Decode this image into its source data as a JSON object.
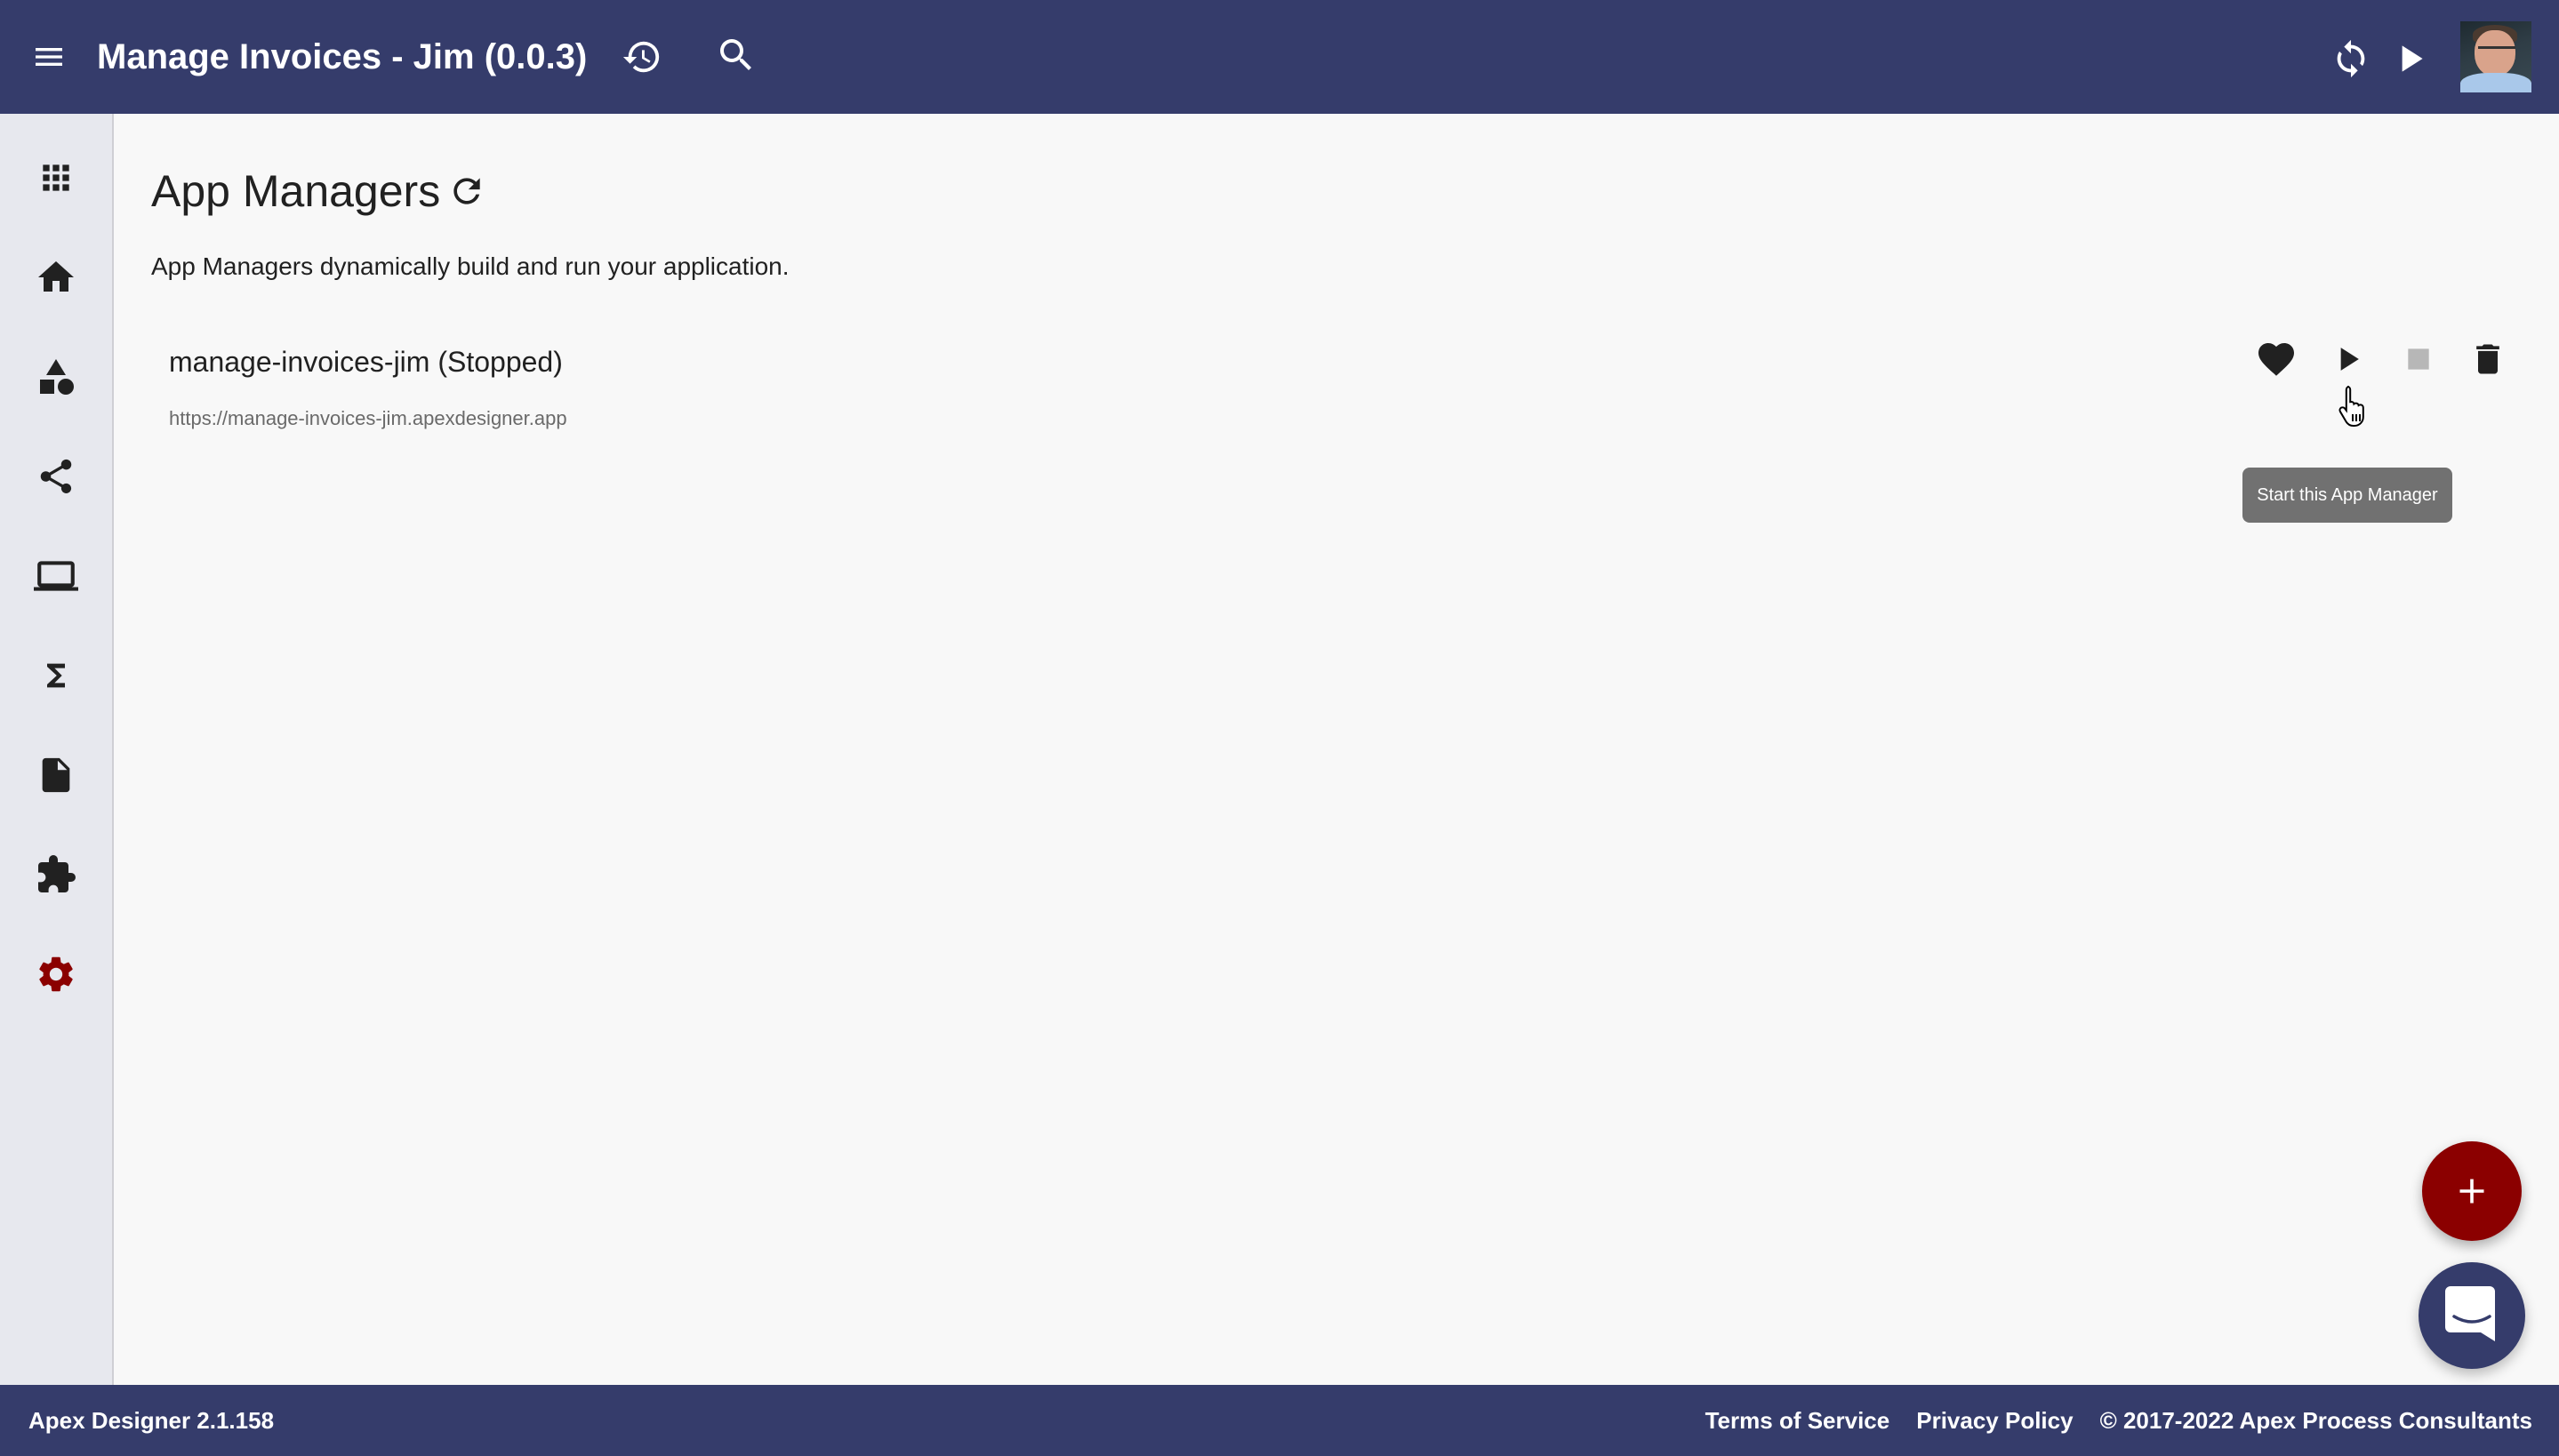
{
  "header": {
    "title": "Manage Invoices - Jim (0.0.3)",
    "icons": [
      "menu-icon",
      "history-icon",
      "search-icon",
      "sync-icon",
      "play-icon",
      "user-avatar"
    ]
  },
  "sidebar": {
    "items": [
      {
        "name": "apps",
        "icon": "apps-grid-icon"
      },
      {
        "name": "home",
        "icon": "home-icon"
      },
      {
        "name": "business-objects",
        "icon": "shapes-icon"
      },
      {
        "name": "processes",
        "icon": "share-icon"
      },
      {
        "name": "user-interfaces",
        "icon": "laptop-icon"
      },
      {
        "name": "functions",
        "icon": "sigma-icon"
      },
      {
        "name": "files",
        "icon": "file-icon"
      },
      {
        "name": "libraries",
        "icon": "extension-icon"
      },
      {
        "name": "settings",
        "icon": "gear-icon",
        "active": true
      }
    ]
  },
  "page": {
    "title": "App Managers",
    "description": "App Managers dynamically build and run your application.",
    "app_managers": [
      {
        "name": "manage-invoices-jim (Stopped)",
        "url": "https://manage-invoices-jim.apexdesigner.app",
        "actions": [
          "favorite",
          "start",
          "stop (disabled)",
          "delete"
        ]
      }
    ],
    "tooltip": "Start this App Manager"
  },
  "fab": {
    "add_label": "+"
  },
  "footer": {
    "version": "Apex Designer 2.1.158",
    "terms": "Terms of Service",
    "privacy": "Privacy Policy",
    "copyright": "© 2017-2022 Apex Process Consultants"
  },
  "colors": {
    "primary": "#353c6b",
    "accent": "#8b0000",
    "sidebar_bg": "#e7e8ee",
    "page_bg": "#f8f8f8",
    "disabled": "#b7b7b7",
    "tooltip_bg": "#717171"
  }
}
